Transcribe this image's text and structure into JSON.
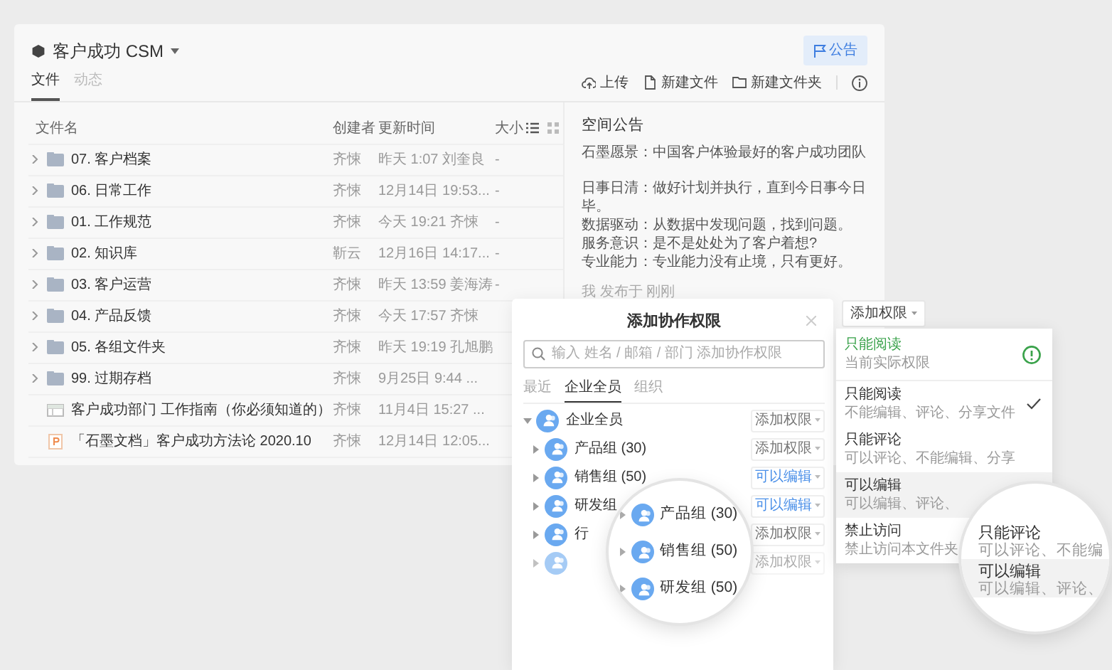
{
  "space": {
    "title": "客户成功 CSM"
  },
  "notice_button": "公告",
  "tabs": [
    {
      "label": "文件",
      "selected": true
    },
    {
      "label": "动态",
      "selected": false
    }
  ],
  "toolbar": [
    {
      "kind": "upload",
      "label": "上传"
    },
    {
      "kind": "file",
      "label": "新建文件"
    },
    {
      "kind": "folder",
      "label": "新建文件夹"
    }
  ],
  "table": {
    "columns": [
      "文件名",
      "创建者",
      "更新时间",
      "大小"
    ],
    "rows": [
      {
        "kind": "folder",
        "name": "07. 客户档案",
        "creator": "齐悚",
        "updated": "昨天 1:07 刘奎良",
        "size": "-"
      },
      {
        "kind": "folder",
        "name": "06. 日常工作",
        "creator": "齐悚",
        "updated": "12月14日 19:53...",
        "size": "-"
      },
      {
        "kind": "folder",
        "name": "01. 工作规范",
        "creator": "齐悚",
        "updated": "今天 19:21 齐悚",
        "size": "-"
      },
      {
        "kind": "folder",
        "name": "02. 知识库",
        "creator": "靳云",
        "updated": "12月16日 14:17...",
        "size": "-"
      },
      {
        "kind": "folder",
        "name": "03. 客户运营",
        "creator": "齐悚",
        "updated": "昨天 13:59 姜海涛",
        "size": "-"
      },
      {
        "kind": "folder",
        "name": "04. 产品反馈",
        "creator": "齐悚",
        "updated": "今天 17:57 齐悚"
      },
      {
        "kind": "folder",
        "name": "05. 各组文件夹",
        "creator": "齐悚",
        "updated": "昨天 19:19 孔旭鹏"
      },
      {
        "kind": "folder",
        "name": "99. 过期存档",
        "creator": "齐悚",
        "updated": "9月25日 9:44 ..."
      },
      {
        "kind": "sheet",
        "name": "客户成功部门 工作指南（你必须知道的）",
        "creator": "齐悚",
        "updated": "11月4日 15:27 ..."
      },
      {
        "kind": "slides",
        "name": "「石墨文档」客户成功方法论 2020.10",
        "creator": "齐悚",
        "updated": "12月14日 12:05..."
      }
    ]
  },
  "announcement": {
    "title": "空间公告",
    "paragraphs": [
      [
        "石墨愿景：中国客户体验最好的客户成功团队"
      ],
      [
        "日事日清：做好计划并执行，直到今日事今日毕。",
        "数据驱动：从数据中发现问题，找到问题。",
        "服务意识：是不是处处为了客户着想?",
        "专业能力：专业能力没有止境，只有更好。"
      ]
    ],
    "footer": "我 发布于 刚刚"
  },
  "dialog": {
    "title": "添加协作权限",
    "search": {
      "placeholder": "输入 姓名 / 邮箱 / 部门 添加协作权限"
    },
    "tabs": [
      {
        "label": "最近",
        "selected": false
      },
      {
        "label": "企业全员",
        "selected": true
      },
      {
        "label": "组织",
        "selected": false
      }
    ],
    "members": [
      {
        "name": "企业全员",
        "expanded": true,
        "permission": "添加权限",
        "granted": false,
        "children": [
          {
            "name": "产品组 (30)",
            "expanded": false,
            "permission": "添加权限",
            "granted": false
          },
          {
            "name": "销售组 (50)",
            "expanded": false,
            "permission": "可以编辑",
            "granted": true
          },
          {
            "name": "研发组",
            "expanded": false,
            "permission": "可以编辑",
            "granted": true
          },
          {
            "name": "行",
            "expanded": false,
            "permission": "添加权限",
            "granted": false
          },
          {
            "expanded": false,
            "permission": "添加权限",
            "granted": false
          }
        ]
      }
    ]
  },
  "magnifier_groups": [
    {
      "name": "产品组 (30)"
    },
    {
      "name": "销售组 (50)"
    },
    {
      "name": "研发组 (50)"
    }
  ],
  "permission_menu": {
    "button": "添加权限",
    "current": {
      "title": "只能阅读",
      "subtitle": "当前实际权限"
    },
    "options": [
      {
        "title": "只能阅读",
        "subtitle": "不能编辑、评论、分享文件",
        "selected": true,
        "hovered": false
      },
      {
        "title": "只能评论",
        "subtitle": "可以评论、不能编辑、分享",
        "selected": false,
        "hovered": false
      },
      {
        "title": "可以编辑",
        "subtitle": "可以编辑、评论、",
        "selected": false,
        "hovered": true
      },
      {
        "title": "禁止访问",
        "subtitle": "禁止访问本文件夹",
        "selected": false,
        "hovered": false
      }
    ]
  },
  "magnifier_options": [
    {
      "title": "只能评论",
      "subtitle": "可以评论、不能编",
      "hovered": false
    },
    {
      "title": "可以编辑",
      "subtitle": "可以编辑、评论、",
      "hovered": true
    }
  ]
}
